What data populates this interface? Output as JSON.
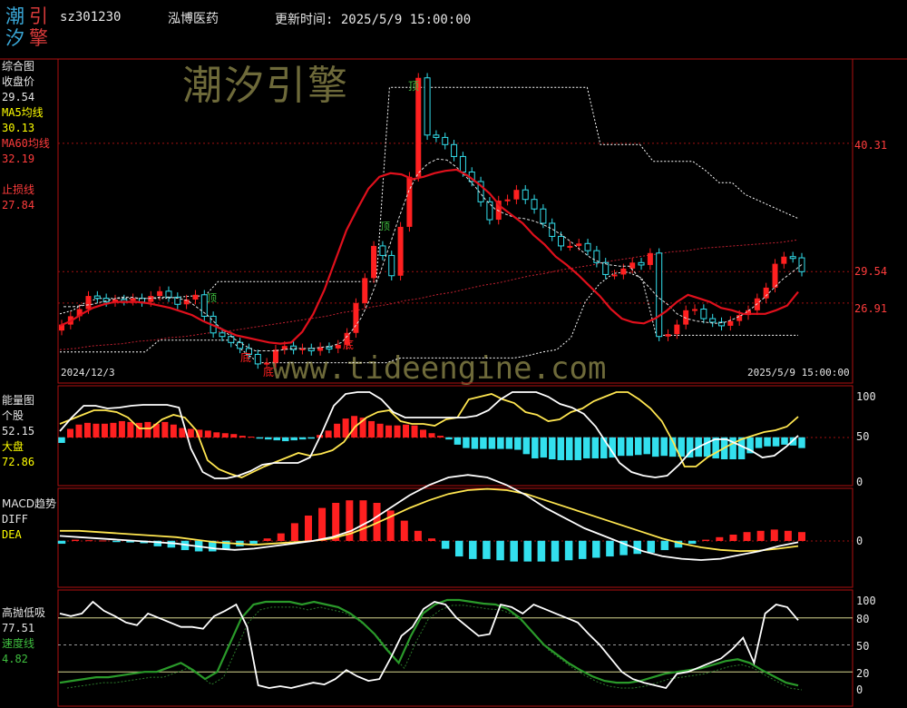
{
  "header": {
    "logo": [
      "潮",
      "引",
      "汐",
      "擎"
    ],
    "code": "sz301230",
    "name": "泓博医药",
    "update": "更新时间: 2025/5/9 15:00:00"
  },
  "watermark": {
    "cn": "潮汐引擎",
    "url": "www.tideengine.com"
  },
  "panel1": {
    "labels": [
      {
        "text": "综合图",
        "color": "#e6e6e6"
      },
      {
        "text": "收盘价",
        "color": "#e6e6e6"
      },
      {
        "text": "29.54",
        "color": "#e6e6e6"
      },
      {
        "text": "MA5均线",
        "color": "#ffff00"
      },
      {
        "text": "30.13",
        "color": "#ffff00"
      },
      {
        "text": "MA60均线",
        "color": "#ff3c3c"
      },
      {
        "text": "32.19",
        "color": "#ff3c3c"
      },
      {
        "text": "",
        "color": "#e6e6e6"
      },
      {
        "text": "止损线",
        "color": "#ff3c3c"
      },
      {
        "text": "27.84",
        "color": "#ff3c3c"
      }
    ],
    "right_axis": [
      "40.31",
      "29.54",
      "26.91"
    ],
    "start_date": "2024/12/3",
    "end_date": "2025/5/9 15:00:00",
    "marks": {
      "top": "顶",
      "bottom": "底"
    }
  },
  "panel2": {
    "labels": [
      {
        "text": "能量图",
        "color": "#e6e6e6"
      },
      {
        "text": "个股",
        "color": "#e6e6e6"
      },
      {
        "text": "52.15",
        "color": "#e6e6e6"
      },
      {
        "text": "大盘",
        "color": "#ffff00"
      },
      {
        "text": "72.86",
        "color": "#ffff00"
      }
    ],
    "axis": [
      "100",
      "50",
      "0"
    ]
  },
  "panel3": {
    "labels": [
      {
        "text": "MACD趋势",
        "color": "#e6e6e6"
      },
      {
        "text": "DIFF",
        "color": "#e6e6e6"
      },
      {
        "text": "DEA",
        "color": "#ffff00"
      }
    ],
    "axis": [
      "0"
    ]
  },
  "panel4": {
    "labels": [
      {
        "text": "高抛低吸",
        "color": "#e6e6e6"
      },
      {
        "text": "77.51",
        "color": "#e6e6e6"
      },
      {
        "text": "速度线",
        "color": "#3fbf3f"
      },
      {
        "text": "4.82",
        "color": "#3fbf3f"
      }
    ],
    "axis": [
      "100",
      "80",
      "50",
      "20",
      "0"
    ]
  },
  "colors": {
    "up": "#ff2020",
    "down": "#33e0ee",
    "ma60": "#e0101c",
    "yellow": "#ffe650",
    "white": "#ffffff",
    "green": "#2a9a2a",
    "frame": "#b01010"
  },
  "chart_data": [
    {
      "type": "candlestick",
      "title": "综合图",
      "x_start": "2024/12/3",
      "x_end": "2025/5/9",
      "y_ticks": [
        40.31,
        29.54,
        26.91
      ],
      "ylim": [
        20.5,
        47.0
      ],
      "close": [
        25.1,
        25.8,
        26.4,
        27.5,
        27.3,
        27.0,
        27.2,
        27.1,
        27.3,
        27.0,
        27.5,
        27.9,
        27.4,
        26.8,
        27.2,
        27.6,
        25.8,
        24.4,
        24.1,
        23.6,
        23.1,
        22.6,
        21.8,
        21.9,
        23.0,
        23.3,
        23.0,
        23.1,
        22.9,
        23.2,
        23.1,
        23.4,
        24.4,
        26.9,
        29.0,
        31.7,
        30.9,
        29.2,
        33.3,
        37.5,
        45.8,
        41.0,
        40.8,
        40.2,
        39.2,
        37.9,
        37.1,
        35.4,
        33.9,
        35.5,
        35.6,
        36.4,
        35.6,
        34.8,
        33.6,
        32.5,
        31.7,
        31.7,
        31.9,
        31.3,
        30.3,
        29.3,
        29.3,
        29.8,
        30.3,
        30.1,
        31.1,
        24.1,
        24.3,
        25.1,
        26.3,
        26.4,
        25.6,
        25.3,
        25.0,
        25.4,
        25.9,
        26.3,
        27.3,
        28.2,
        30.2,
        30.8,
        30.7,
        29.54
      ],
      "ma5_close": [
        26.6,
        26.6,
        26.7,
        26.8,
        27.0,
        27.2,
        27.4,
        27.4,
        27.3,
        27.3,
        27.4,
        27.4,
        27.3,
        27.1,
        26.5,
        25.9,
        25.1,
        24.4,
        23.8,
        23.3,
        22.9,
        22.9,
        22.9,
        23.0,
        23.1,
        23.1,
        23.1,
        23.2,
        23.3,
        23.6,
        24.5,
        25.6,
        27.3,
        29.4,
        31.7,
        34.1,
        36.3,
        37.8,
        38.6,
        39.0,
        38.9,
        38.3,
        37.5,
        36.6,
        35.6,
        34.8,
        34.4,
        34.1,
        34.0,
        33.8,
        33.5,
        33.1,
        32.6,
        32.0,
        31.3,
        30.7,
        30.3,
        30.1,
        30.0,
        30.0,
        29.1,
        28.3,
        27.4,
        26.8,
        26.0,
        25.6,
        25.4,
        25.3,
        25.2,
        25.3,
        25.6,
        26.0,
        26.6,
        27.3,
        28.1,
        28.9,
        29.5,
        30.13
      ],
      "ma60_close": [
        23.0,
        23.1,
        23.3,
        23.4,
        23.5,
        23.7,
        23.8,
        24.0,
        24.1,
        24.3,
        24.5,
        24.6,
        24.8,
        25.0,
        25.2,
        25.4,
        25.6,
        25.8,
        26.1,
        26.3,
        26.6,
        26.8,
        27.1,
        27.3,
        27.6,
        27.8,
        28.1,
        28.4,
        28.6,
        28.9,
        29.2,
        29.4,
        29.7,
        29.9,
        30.1,
        30.4,
        30.6,
        30.8,
        31.0,
        31.2,
        31.3,
        31.5,
        31.6,
        31.7,
        31.8,
        31.9,
        32.0,
        32.19
      ],
      "ma_red_close": [
        25.0,
        25.4,
        26.0,
        26.5,
        26.8,
        27.0,
        27.0,
        27.0,
        26.9,
        26.7,
        26.5,
        26.2,
        25.9,
        25.4,
        25.0,
        24.6,
        24.2,
        24.0,
        23.8,
        23.6,
        23.5,
        23.6,
        24.5,
        26.0,
        28.0,
        30.5,
        33.0,
        34.8,
        36.5,
        37.5,
        37.8,
        37.7,
        37.3,
        37.5,
        37.8,
        38.0,
        38.1,
        37.6,
        36.9,
        36.1,
        35.0,
        34.3,
        33.6,
        32.6,
        31.8,
        30.8,
        30.1,
        29.3,
        28.4,
        27.5,
        26.4,
        25.6,
        25.3,
        25.2,
        25.6,
        26.2,
        27.0,
        27.6,
        27.3,
        27.0,
        26.5,
        26.3,
        26.0,
        26.0,
        26.0,
        26.3,
        26.7,
        27.84
      ],
      "channel_upper_close": [
        26.0,
        26.3,
        27.0,
        27.3,
        27.3,
        27.3,
        27.3,
        27.3,
        27.3,
        27.4,
        27.5,
        27.5,
        28.7,
        28.7,
        28.7,
        28.7,
        28.7,
        28.7,
        28.7,
        28.7,
        28.7,
        28.7,
        28.7,
        28.7,
        28.7,
        45.0,
        45.0,
        45.0,
        45.0,
        45.0,
        45.0,
        45.0,
        45.0,
        45.0,
        45.0,
        45.0,
        45.0,
        45.0,
        45.0,
        45.0,
        45.0,
        40.2,
        40.2,
        40.2,
        40.2,
        38.8,
        38.8,
        38.8,
        38.8,
        38.0,
        37.0,
        37.0,
        36.0,
        35.5,
        35.0,
        34.5,
        34.0
      ],
      "channel_lower_close": [
        22.8,
        22.8,
        22.8,
        22.8,
        22.8,
        22.8,
        22.8,
        23.8,
        23.8,
        23.8,
        23.8,
        23.8,
        23.8,
        22.8,
        21.9,
        21.9,
        21.9,
        21.9,
        21.9,
        21.9,
        21.9,
        21.9,
        21.9,
        21.9,
        22.3,
        22.3,
        22.3,
        22.3,
        22.3,
        22.3,
        22.3,
        22.3,
        22.3,
        22.5,
        22.8,
        23.0,
        24.0,
        27.0,
        28.5,
        29.4,
        29.5,
        29.0,
        24.2,
        24.2,
        24.2,
        24.2,
        24.2,
        24.2,
        24.2,
        24.2,
        24.2,
        24.2,
        24.2
      ]
    },
    {
      "type": "bar+line",
      "title": "能量图",
      "ylim": [
        0,
        100
      ],
      "y_ticks": [
        100,
        50,
        0
      ],
      "histogram": [
        -6,
        10,
        15,
        17,
        16,
        16,
        17,
        19,
        18,
        17,
        18,
        16,
        18,
        15,
        11,
        10,
        9,
        8,
        6,
        5,
        4,
        2,
        1,
        -1,
        -2,
        -3,
        -4,
        -3,
        -2,
        -1,
        3,
        8,
        16,
        22,
        25,
        23,
        19,
        16,
        14,
        14,
        15,
        14,
        9,
        5,
        2,
        -2,
        -8,
        -12,
        -13,
        -13,
        -13,
        -13,
        -13,
        -14,
        -19,
        -24,
        -23,
        -25,
        -26,
        -26,
        -26,
        -24,
        -24,
        -24,
        -23,
        -21,
        -21,
        -20,
        -19,
        -22,
        -21,
        -22,
        -22,
        -23,
        -22,
        -22,
        -24,
        -25,
        -25,
        -25,
        -18,
        -12,
        -10,
        -10,
        -8,
        -9,
        -12
      ],
      "stock": [
        57,
        72,
        85,
        85,
        82,
        83,
        85,
        86,
        86,
        86,
        83,
        38,
        12,
        5,
        5,
        8,
        13,
        20,
        22,
        22,
        22,
        28,
        55,
        85,
        98,
        100,
        100,
        92,
        78,
        72,
        72,
        72,
        72,
        72,
        72,
        74,
        80,
        92,
        100,
        100,
        100,
        95,
        87,
        83,
        76,
        62,
        42,
        22,
        12,
        8,
        6,
        8,
        20,
        35,
        42,
        48,
        48,
        42,
        36,
        28,
        30,
        40,
        52.15
      ],
      "market": [
        65,
        70,
        75,
        80,
        80,
        78,
        72,
        60,
        60,
        70,
        75,
        72,
        58,
        25,
        15,
        10,
        6,
        12,
        18,
        23,
        28,
        33,
        30,
        32,
        36,
        45,
        62,
        72,
        78,
        80,
        68,
        65,
        65,
        63,
        70,
        72,
        92,
        95,
        98,
        92,
        88,
        78,
        75,
        68,
        70,
        78,
        82,
        90,
        95,
        100,
        100,
        92,
        82,
        68,
        45,
        18,
        18,
        28,
        35,
        42,
        48,
        52,
        56,
        58,
        62,
        72.86
      ]
    },
    {
      "type": "bar+line",
      "title": "MACD趋势",
      "zero": 0,
      "histogram": [
        -0.1,
        0.05,
        0.03,
        0.02,
        -0.02,
        -0.05,
        -0.08,
        -0.2,
        -0.25,
        -0.35,
        -0.4,
        -0.4,
        -0.3,
        -0.2,
        -0.1,
        0.1,
        0.3,
        0.7,
        1.0,
        1.3,
        1.5,
        1.6,
        1.6,
        1.5,
        1.2,
        0.8,
        0.4,
        0.1,
        -0.3,
        -0.6,
        -0.7,
        -0.7,
        -0.75,
        -0.8,
        -0.8,
        -0.8,
        -0.8,
        -0.75,
        -0.7,
        -0.65,
        -0.6,
        -0.55,
        -0.5,
        -0.45,
        -0.35,
        -0.25,
        -0.1,
        0.05,
        0.15,
        0.25,
        0.35,
        0.4,
        0.45,
        0.4,
        0.35
      ],
      "diff": [
        0.2,
        0.15,
        0.1,
        0.05,
        0.0,
        -0.05,
        -0.1,
        -0.2,
        -0.3,
        -0.35,
        -0.3,
        -0.2,
        -0.1,
        0.0,
        0.15,
        0.4,
        0.8,
        1.3,
        1.8,
        2.2,
        2.5,
        2.6,
        2.5,
        2.2,
        1.8,
        1.3,
        0.9,
        0.5,
        0.2,
        -0.1,
        -0.4,
        -0.6,
        -0.7,
        -0.75,
        -0.7,
        -0.55,
        -0.4,
        -0.2,
        -0.05
      ],
      "dea": [
        0.4,
        0.4,
        0.35,
        0.3,
        0.25,
        0.2,
        0.15,
        0.05,
        -0.05,
        -0.1,
        -0.15,
        -0.1,
        -0.05,
        0.0,
        0.1,
        0.3,
        0.6,
        0.95,
        1.3,
        1.6,
        1.85,
        2.0,
        2.05,
        2.0,
        1.85,
        1.6,
        1.35,
        1.1,
        0.85,
        0.6,
        0.35,
        0.1,
        -0.1,
        -0.25,
        -0.35,
        -0.4,
        -0.38,
        -0.3,
        -0.2
      ]
    },
    {
      "type": "line",
      "title": "高抛低吸",
      "ylim": [
        0,
        100
      ],
      "y_ticks": [
        100,
        80,
        50,
        20,
        0
      ],
      "white": [
        85,
        82,
        85,
        98,
        88,
        82,
        75,
        72,
        85,
        80,
        75,
        70,
        70,
        68,
        82,
        88,
        95,
        70,
        5,
        2,
        4,
        2,
        5,
        8,
        6,
        12,
        22,
        15,
        10,
        12,
        35,
        60,
        70,
        90,
        98,
        95,
        80,
        70,
        60,
        62,
        95,
        92,
        85,
        95,
        90,
        85,
        80,
        75,
        62,
        50,
        35,
        20,
        12,
        8,
        5,
        2,
        18,
        20,
        25,
        30,
        35,
        45,
        58,
        30,
        85,
        95,
        92,
        77.51
      ],
      "speed": [
        8,
        10,
        12,
        14,
        14,
        16,
        18,
        20,
        20,
        25,
        30,
        22,
        12,
        20,
        50,
        80,
        95,
        98,
        98,
        98,
        95,
        98,
        95,
        92,
        85,
        75,
        62,
        45,
        30,
        60,
        85,
        95,
        100,
        100,
        98,
        96,
        95,
        90,
        80,
        65,
        50,
        40,
        30,
        22,
        15,
        10,
        8,
        8,
        10,
        14,
        18,
        20,
        22,
        24,
        28,
        32,
        34,
        30,
        22,
        15,
        8,
        4.82
      ]
    }
  ]
}
